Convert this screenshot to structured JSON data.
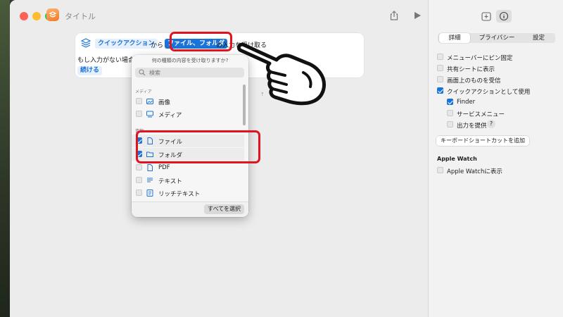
{
  "window": {
    "title": "タイトル"
  },
  "card": {
    "quick_action": "クイックアクション",
    "from": "から",
    "files_folders": "ファイル、フォルダ",
    "receive": "の入力を受け取る",
    "if_no_input": "もし入力がない場合:",
    "continue": "続ける"
  },
  "popover": {
    "header": "何の種類の内容を受け取りますか?",
    "search_placeholder": "検索",
    "section_media": "メディア",
    "section_docs": "書類",
    "items": [
      {
        "label": "画像",
        "checked": false,
        "icon": "image-icon"
      },
      {
        "label": "メディア",
        "checked": false,
        "icon": "media-icon"
      },
      {
        "label": "ファイル",
        "checked": true,
        "icon": "file-icon"
      },
      {
        "label": "フォルダ",
        "checked": true,
        "icon": "folder-icon"
      },
      {
        "label": "PDF",
        "checked": false,
        "icon": "pdf-icon"
      },
      {
        "label": "テキスト",
        "checked": false,
        "icon": "text-icon"
      },
      {
        "label": "リッチテキスト",
        "checked": false,
        "icon": "rich-text-icon"
      }
    ],
    "select_all": "すべてを選択"
  },
  "sidebar": {
    "tabs": [
      "詳細",
      "プライバシー",
      "設定"
    ],
    "active_tab": 0,
    "options": [
      {
        "label": "メニューバーにピン固定",
        "checked": false
      },
      {
        "label": "共有シートに表示",
        "checked": false
      },
      {
        "label": "画面上のものを受信",
        "checked": false
      },
      {
        "label": "クイックアクションとして使用",
        "checked": true
      }
    ],
    "sub_options": [
      {
        "label": "Finder",
        "checked": true
      },
      {
        "label": "サービスメニュー",
        "checked": false
      },
      {
        "label": "出力を提供",
        "checked": false
      }
    ],
    "help_label": "?",
    "keyboard_shortcut_button": "キーボードショートカットを追加",
    "apple_watch_title": "Apple Watch",
    "apple_watch_option": {
      "label": "Apple Watchに表示",
      "checked": false
    }
  },
  "colors": {
    "accent": "#1a73d8",
    "highlight_border": "#e0141e"
  }
}
